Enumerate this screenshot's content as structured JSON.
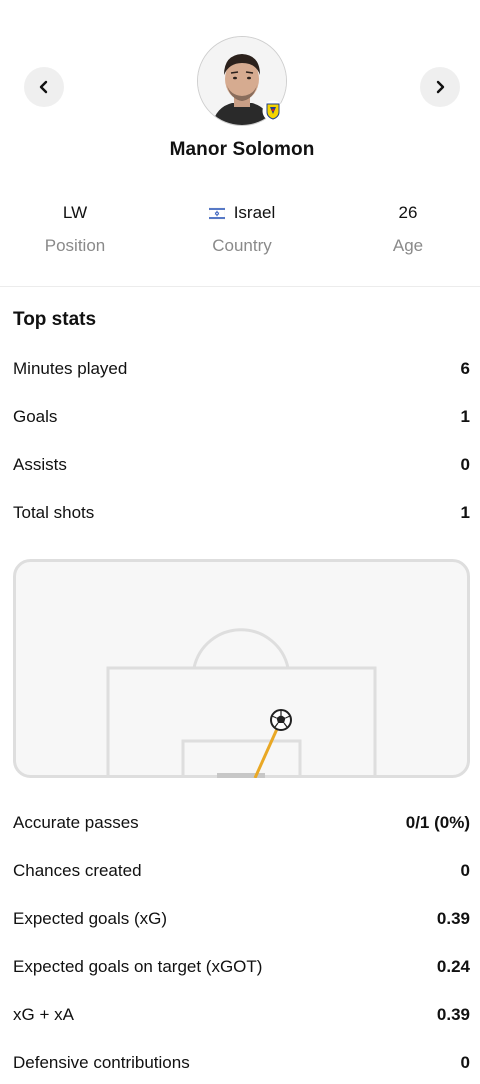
{
  "player": {
    "name": "Manor Solomon",
    "position": "LW",
    "country": "Israel",
    "age": "26",
    "labels": {
      "position": "Position",
      "country": "Country",
      "age": "Age"
    }
  },
  "icons": {
    "prev": "chevron-left-icon",
    "next": "chevron-right-icon",
    "flag": "israel-flag-icon",
    "club": "villarreal-badge-icon",
    "ball": "football-icon"
  },
  "colors": {
    "shot_line": "#e9a825",
    "pitch_line": "#dedede",
    "pitch_bg": "#f7f7f7"
  },
  "top_stats": {
    "title": "Top stats",
    "rows_top": [
      {
        "label": "Minutes played",
        "value": "6"
      },
      {
        "label": "Goals",
        "value": "1"
      },
      {
        "label": "Assists",
        "value": "0"
      },
      {
        "label": "Total shots",
        "value": "1"
      }
    ],
    "rows_bottom": [
      {
        "label": "Accurate passes",
        "value": "0/1 (0%)"
      },
      {
        "label": "Chances created",
        "value": "0"
      },
      {
        "label": "Expected goals (xG)",
        "value": "0.39"
      },
      {
        "label": "Expected goals on target (xGOT)",
        "value": "0.24"
      },
      {
        "label": "xG + xA",
        "value": "0.39"
      },
      {
        "label": "Defensive contributions",
        "value": "0"
      }
    ]
  }
}
